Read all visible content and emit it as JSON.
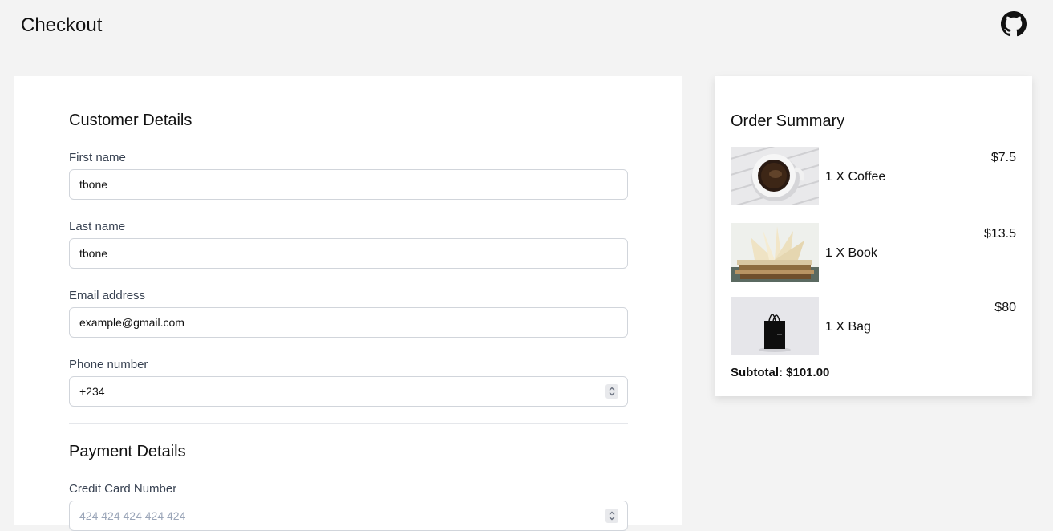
{
  "header": {
    "title": "Checkout",
    "github_icon": "github-icon"
  },
  "customer": {
    "heading": "Customer Details",
    "first_name": {
      "label": "First name",
      "value": "tbone"
    },
    "last_name": {
      "label": "Last name",
      "value": "tbone"
    },
    "email": {
      "label": "Email address",
      "value": "example@gmail.com"
    },
    "phone": {
      "label": "Phone number",
      "value": "+234"
    }
  },
  "payment": {
    "heading": "Payment Details",
    "card_number": {
      "label": "Credit Card Number",
      "placeholder": "424 424 424 424 424"
    }
  },
  "summary": {
    "heading": "Order Summary",
    "items": [
      {
        "name": "1 X Coffee",
        "price": "$7.5",
        "image": "coffee-cup"
      },
      {
        "name": "1 X Book",
        "price": "$13.5",
        "image": "open-book-stack"
      },
      {
        "name": "1 X Bag",
        "price": "$80",
        "image": "black-shopping-bag"
      }
    ],
    "subtotal": "Subtotal: $101.00"
  },
  "colors": {
    "page_bg": "#f3f3f3",
    "card_bg": "#ffffff",
    "input_border": "#d1d5db",
    "label_text": "#374151",
    "placeholder_text": "#9aa5b8"
  }
}
